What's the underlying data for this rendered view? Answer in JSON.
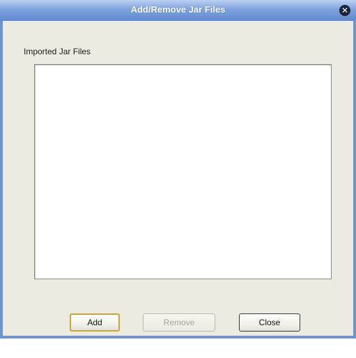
{
  "window": {
    "title": "Add/Remove Jar Files",
    "close_glyph": "✕",
    "accent_color": "#6f95d0",
    "background_color": "#ecebe2"
  },
  "jar_list": {
    "label": "Imported Jar Files",
    "items": []
  },
  "buttons": {
    "add": "Add",
    "remove": "Remove",
    "close": "Close"
  }
}
